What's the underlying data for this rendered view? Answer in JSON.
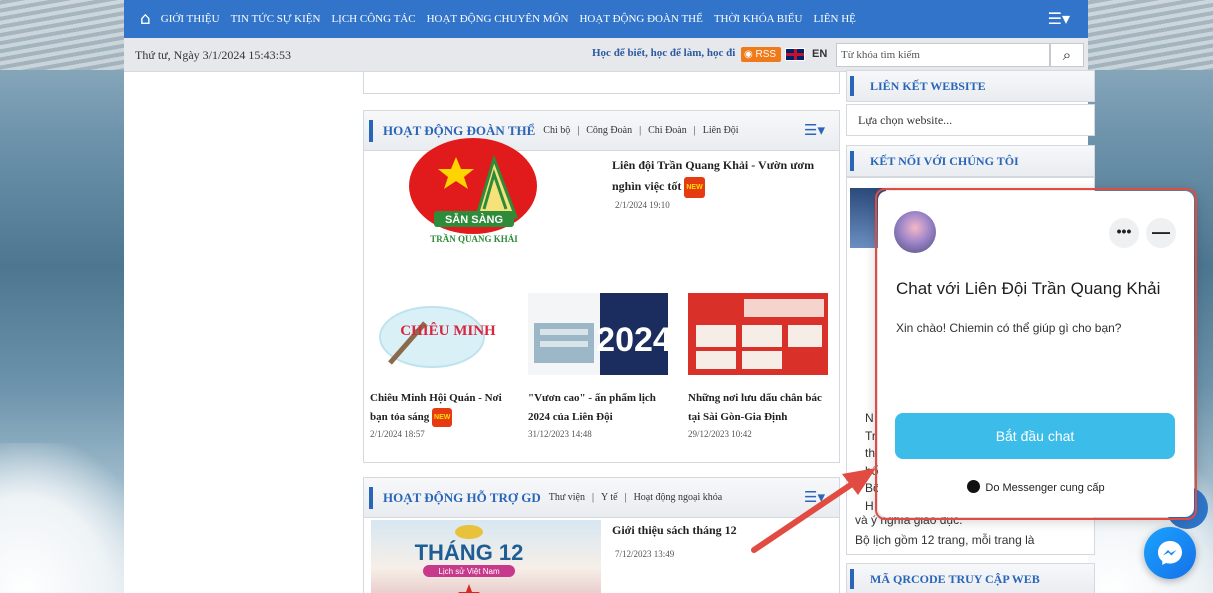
{
  "nav": {
    "items": [
      "GIỚI THIỆU",
      "TIN TỨC SỰ KIỆN",
      "LỊCH CÔNG TÁC",
      "HOẠT ĐỘNG CHUYÊN MÔN",
      "HOẠT ĐỘNG ĐOÀN THỂ",
      "THỜI KHÓA BIỂU",
      "LIÊN HỆ"
    ],
    "menu_glyph": "☰▾"
  },
  "topbar": {
    "date": "Thứ tư, Ngày 3/1/2024 15:43:53",
    "slogan": "Học để biết, học để làm, học đi",
    "rss": "RSS",
    "lang": "EN",
    "search_placeholder": "Từ khóa tìm kiếm"
  },
  "section1": {
    "title": "HOẠT ĐỘNG ĐOÀN THỂ",
    "subs": [
      "Chi bộ",
      "Công Đoàn",
      "Chi Đoàn",
      "Liên Đội"
    ],
    "featured": {
      "title": "Liên đội Trần Quang Khải - Vườn ươm nghìn việc tốt",
      "date": "2/1/2024 19:10",
      "logo_top": "SẴN SÀNG",
      "logo_bottom": "TRẦN QUANG KHẢI"
    },
    "posts": [
      {
        "title": "Chiêu Minh Hội Quán - Nơi bạn tỏa sáng",
        "date": "2/1/2024 18:57",
        "image_text": "CHIÊU MINH"
      },
      {
        "title": "\"Vươn cao\" - ấn phẩm lịch 2024 của Liên Đội",
        "date": "31/12/2023 14:48",
        "image_text": "2024"
      },
      {
        "title": "Những nơi lưu dấu chân bác tại Sài Gòn-Gia Định",
        "date": "29/12/2023 10:42",
        "image_text": ""
      }
    ],
    "new_label": "NEW"
  },
  "section2": {
    "title": "HOẠT ĐỘNG HỖ TRỢ GD",
    "subs": [
      "Thư viện",
      "Y tế",
      "Hoạt động ngoại khóa"
    ],
    "featured": {
      "title": "Giới thiệu sách tháng 12",
      "date": "7/12/2023 13:49",
      "image_text": "THÁNG 12",
      "image_sub": "Lịch sử Việt Nam"
    }
  },
  "right": {
    "links_title": "LIÊN KẾT WEBSITE",
    "select_web": "Lựa chọn website...",
    "connect_title": "KẾT NỐI VỚI CHÚNG TÔI",
    "fb_lines": [
      "N",
      "Tr",
      "th",
      "bố",
      "Bộ",
      "H",
      "và ý nghĩa giáo dục.",
      "Bộ lịch gồm 12 trang, mỗi trang là"
    ],
    "qr_title": "MÃ QRCODE TRUY CẬP WEB"
  },
  "chat": {
    "title": "Chat với Liên Đội Trần Quang Khải",
    "greeting": "Xin chào! Chiemin có thể giúp gì cho bạn?",
    "start_label": "Bắt đầu chat",
    "more_label": "•••",
    "minimize_label": "—",
    "powered": "Do Messenger cung cấp"
  },
  "colors": {
    "nav": "#3174c9",
    "accent": "#2a66b8",
    "chat_button": "#3bbce9",
    "annotation": "#e24b41"
  }
}
